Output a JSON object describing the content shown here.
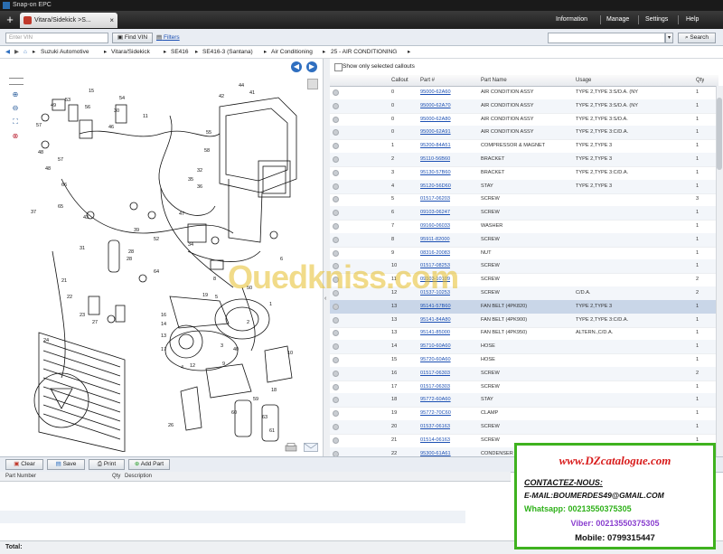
{
  "window": {
    "title": "Snap-on EPC"
  },
  "menubar": {
    "new_tab": "+",
    "tab_label": "Vitara/Sidekick >S...",
    "tab_close": "×",
    "menu": [
      "Information",
      "Manage",
      "Settings",
      "Help"
    ]
  },
  "toolbar": {
    "vin_placeholder": "Enter VIN",
    "find_vin": "Find VIN",
    "filters": "Filters",
    "search_button": "Search"
  },
  "breadcrumb": [
    "Suzuki Automotive",
    "Vitara/Sidekick",
    "SE416",
    "SE416-3 (Santana)",
    "Air Conditioning",
    "25 - AIR CONDITIONING"
  ],
  "options": {
    "show_selected": "Show only selected callouts"
  },
  "diagram": {
    "callouts": [
      "53",
      "56",
      "54",
      "49",
      "57",
      "48",
      "46",
      "30",
      "11",
      "15",
      "28",
      "66",
      "60",
      "59",
      "48",
      "57",
      "35",
      "36",
      "32",
      "13",
      "16",
      "50",
      "6",
      "4",
      "18",
      "24",
      "63",
      "61",
      "17",
      "14",
      "12",
      "8",
      "2",
      "23",
      "27",
      "5",
      "21",
      "22",
      "1",
      "28",
      "44",
      "41",
      "42",
      "55",
      "58",
      "65",
      "64",
      "34",
      "31",
      "37",
      "43",
      "47",
      "19",
      "40",
      "3",
      "9",
      "10",
      "26",
      "39",
      "52"
    ]
  },
  "table": {
    "headers": [
      "Callout",
      "Part #",
      "Part Name",
      "Usage",
      "Qty"
    ],
    "rows": [
      {
        "callout": "0",
        "part": "95000-62A60",
        "name": "AIR CONDITION ASSY",
        "usage": "TYPE 2,TYPE 3:S/D.A. (NY",
        "qty": "1"
      },
      {
        "callout": "0",
        "part": "95000-62A70",
        "name": "AIR CONDITION ASSY",
        "usage": "TYPE 2,TYPE 3:S/D.A. (NY",
        "qty": "1"
      },
      {
        "callout": "0",
        "part": "95000-62A80",
        "name": "AIR CONDITION ASSY",
        "usage": "TYPE 2,TYPE 3:S/D.A.",
        "qty": "1"
      },
      {
        "callout": "0",
        "part": "95000-62A91",
        "name": "AIR CONDITION ASSY",
        "usage": "TYPE 2,TYPE 3:C/D.A.",
        "qty": "1"
      },
      {
        "callout": "1",
        "part": "95200-84A51",
        "name": "COMPRESSOR & MAGNET",
        "usage": "TYPE 2,TYPE 3",
        "qty": "1"
      },
      {
        "callout": "2",
        "part": "95110-56B60",
        "name": "BRACKET",
        "usage": "TYPE 2,TYPE 3",
        "qty": "1"
      },
      {
        "callout": "3",
        "part": "95130-57B60",
        "name": "BRACKET",
        "usage": "TYPE 2,TYPE 3:C/D.A.",
        "qty": "1"
      },
      {
        "callout": "4",
        "part": "95120-56D60",
        "name": "STAY",
        "usage": "TYPE 2,TYPE 3",
        "qty": "1"
      },
      {
        "callout": "5",
        "part": "01517-06203",
        "name": "SCREW",
        "usage": "",
        "qty": "3"
      },
      {
        "callout": "6",
        "part": "09103-06247",
        "name": "SCREW",
        "usage": "",
        "qty": "1"
      },
      {
        "callout": "7",
        "part": "09160-06033",
        "name": "WASHER",
        "usage": "",
        "qty": "1"
      },
      {
        "callout": "8",
        "part": "95911-82000",
        "name": "SCREW",
        "usage": "",
        "qty": "1"
      },
      {
        "callout": "9",
        "part": "08316-20083",
        "name": "NUT",
        "usage": "",
        "qty": "1"
      },
      {
        "callout": "10",
        "part": "01517-08253",
        "name": "SCREW",
        "usage": "",
        "qty": "1"
      },
      {
        "callout": "11",
        "part": "09103-10109",
        "name": "SCREW",
        "usage": "",
        "qty": "2"
      },
      {
        "callout": "12",
        "part": "01537-10253",
        "name": "SCREW",
        "usage": "C/D.A.",
        "qty": "2"
      },
      {
        "callout": "13",
        "part": "95141-57B60",
        "name": "FAN BELT (4PK820)",
        "usage": "TYPE 2,TYPE 3",
        "qty": "1"
      },
      {
        "callout": "13",
        "part": "95141-84A80",
        "name": "FAN BELT (4PK900)",
        "usage": "TYPE 2,TYPE 3:C/D.A.",
        "qty": "1"
      },
      {
        "callout": "13",
        "part": "95141-85000",
        "name": "FAN BELT (4PK950)",
        "usage": "ALTERN.,C/D.A.",
        "qty": "1"
      },
      {
        "callout": "14",
        "part": "95710-60A60",
        "name": "HOSE",
        "usage": "",
        "qty": "1"
      },
      {
        "callout": "15",
        "part": "95720-60A60",
        "name": "HOSE",
        "usage": "",
        "qty": "1"
      },
      {
        "callout": "16",
        "part": "01517-06303",
        "name": "SCREW",
        "usage": "",
        "qty": "2"
      },
      {
        "callout": "17",
        "part": "01517-06303",
        "name": "SCREW",
        "usage": "",
        "qty": "1"
      },
      {
        "callout": "18",
        "part": "95772-60A60",
        "name": "STAY",
        "usage": "",
        "qty": "1"
      },
      {
        "callout": "19",
        "part": "95772-70C60",
        "name": "CLAMP",
        "usage": "",
        "qty": "1"
      },
      {
        "callout": "20",
        "part": "01537-06163",
        "name": "SCREW",
        "usage": "",
        "qty": "1"
      },
      {
        "callout": "21",
        "part": "01514-06163",
        "name": "SCREW",
        "usage": "",
        "qty": "1"
      },
      {
        "callout": "22",
        "part": "95300-61A61",
        "name": "CONDENSER",
        "usage": "",
        "qty": "1"
      }
    ],
    "selected_index": 16
  },
  "bottom_toolbar": {
    "clear": "Clear",
    "save": "Save",
    "print": "Print",
    "add_part": "Add Part"
  },
  "bottom_list": {
    "headers": [
      "Part Number",
      "Qty",
      "Description"
    ]
  },
  "total": {
    "label": "Total:"
  },
  "watermark": "Ouedkniss.com",
  "ad": {
    "site": "www.DZcatalogue.com",
    "contact": "CONTACTEZ-NOUS:",
    "email": "E-MAIL:BOUMERDES49@GMAIL.COM",
    "whatsapp": "Whatsapp: 00213550375305",
    "viber": "Viber: 00213550375305",
    "mobile": "Mobile: 0799315447"
  },
  "colors": {
    "accent": "#2f6fc0",
    "link": "#1b4fb3",
    "ad_border": "#3fb21f",
    "ad_site": "#d81b1b"
  }
}
